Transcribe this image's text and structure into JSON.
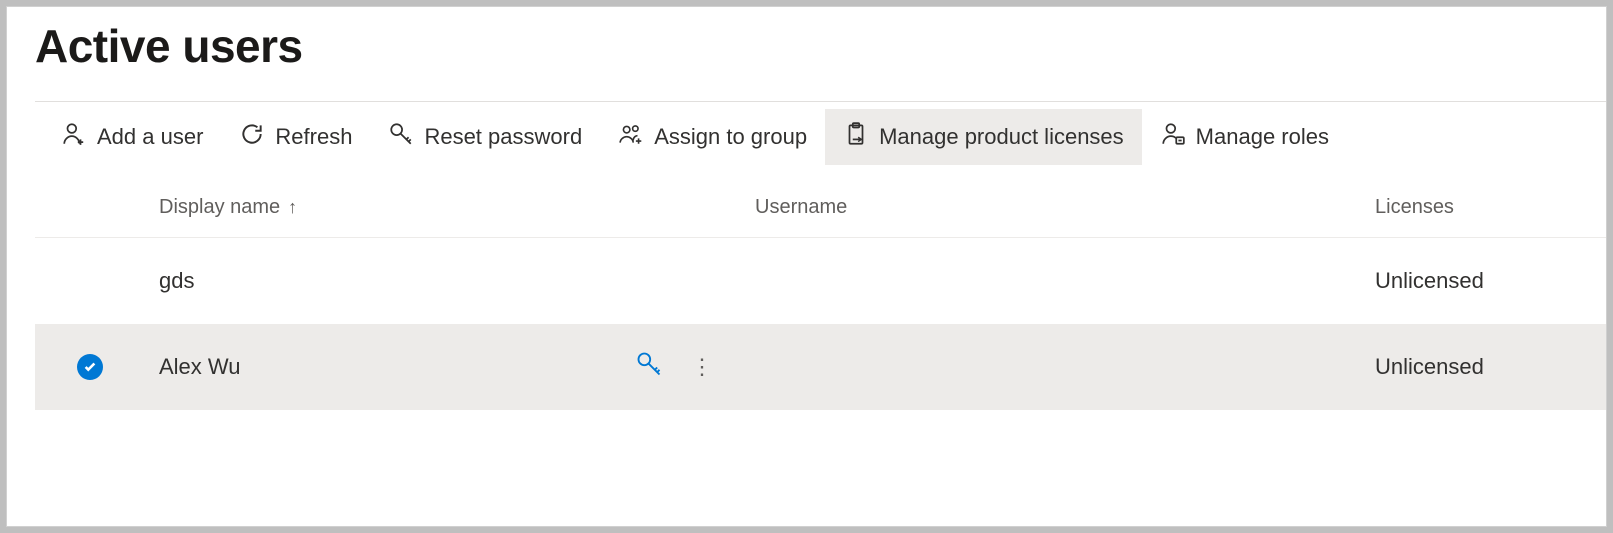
{
  "page": {
    "title": "Active users"
  },
  "toolbar": {
    "add_user": "Add a user",
    "refresh": "Refresh",
    "reset_password": "Reset password",
    "assign_group": "Assign to group",
    "manage_licenses": "Manage product licenses",
    "manage_roles": "Manage roles"
  },
  "columns": {
    "display_name": "Display name",
    "sort_indicator": "↑",
    "username": "Username",
    "licenses": "Licenses"
  },
  "rows": [
    {
      "selected": false,
      "display_name": "gds",
      "username": "",
      "licenses": "Unlicensed"
    },
    {
      "selected": true,
      "display_name": "Alex Wu",
      "username": "",
      "licenses": "Unlicensed"
    }
  ]
}
